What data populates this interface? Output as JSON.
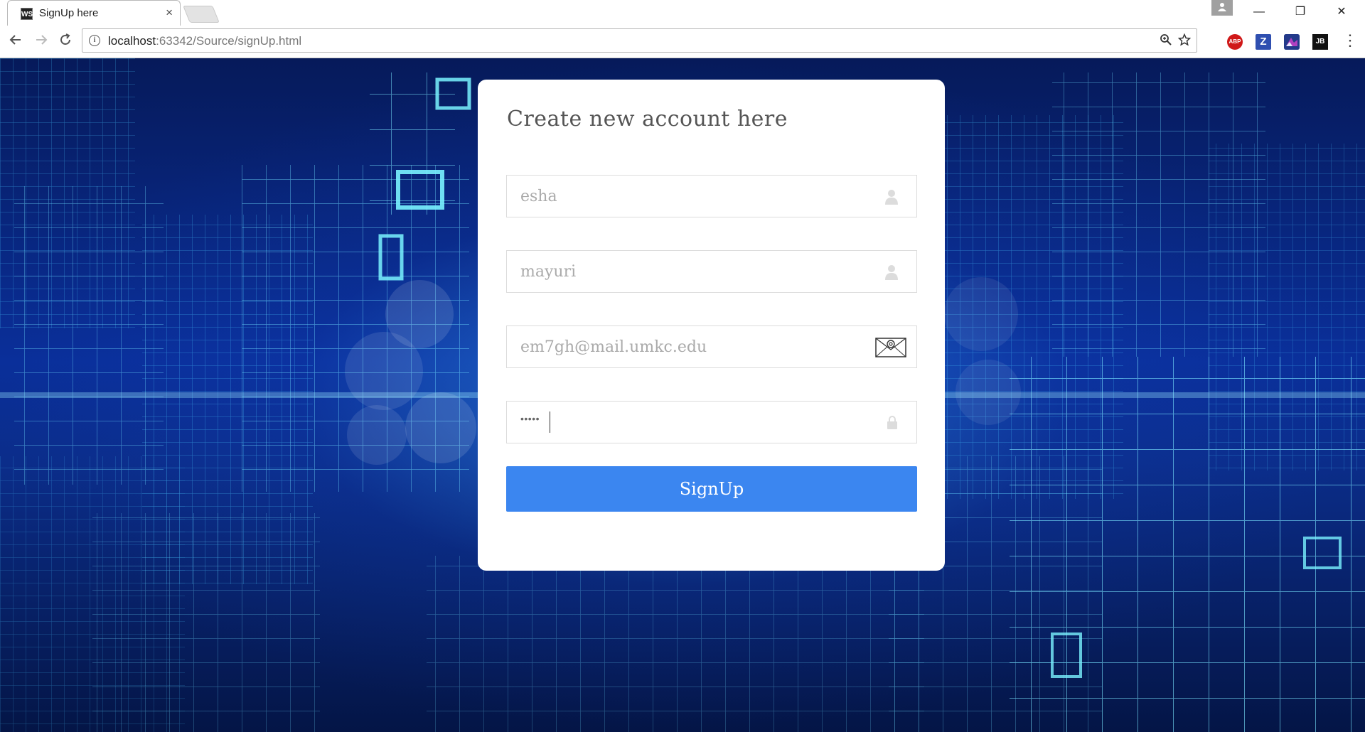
{
  "browser": {
    "tab_title": "SignUp here",
    "tab_favicon": "WS",
    "tab_close": "×",
    "url_host": "localhost",
    "url_path": ":63342/Source/signUp.html",
    "extensions": {
      "abp_label": "ABP",
      "z_label": "Z",
      "jb_label": "JB"
    },
    "window_controls": {
      "minimize": "—",
      "restore": "❐",
      "close": "✕"
    }
  },
  "form": {
    "title": "Create new account here",
    "first_name": {
      "value": "esha",
      "icon": "user-icon"
    },
    "last_name": {
      "value": "mayuri",
      "icon": "user-icon"
    },
    "email": {
      "value": "em7gh@mail.umkc.edu",
      "icon": "envelope-at-icon"
    },
    "password": {
      "masked_value": "•••••",
      "icon": "lock-icon"
    },
    "submit_label": "SignUp"
  },
  "colors": {
    "accent_button": "#3b86f0",
    "background_dark": "#061a5a",
    "background_glow": "#3caaff"
  }
}
